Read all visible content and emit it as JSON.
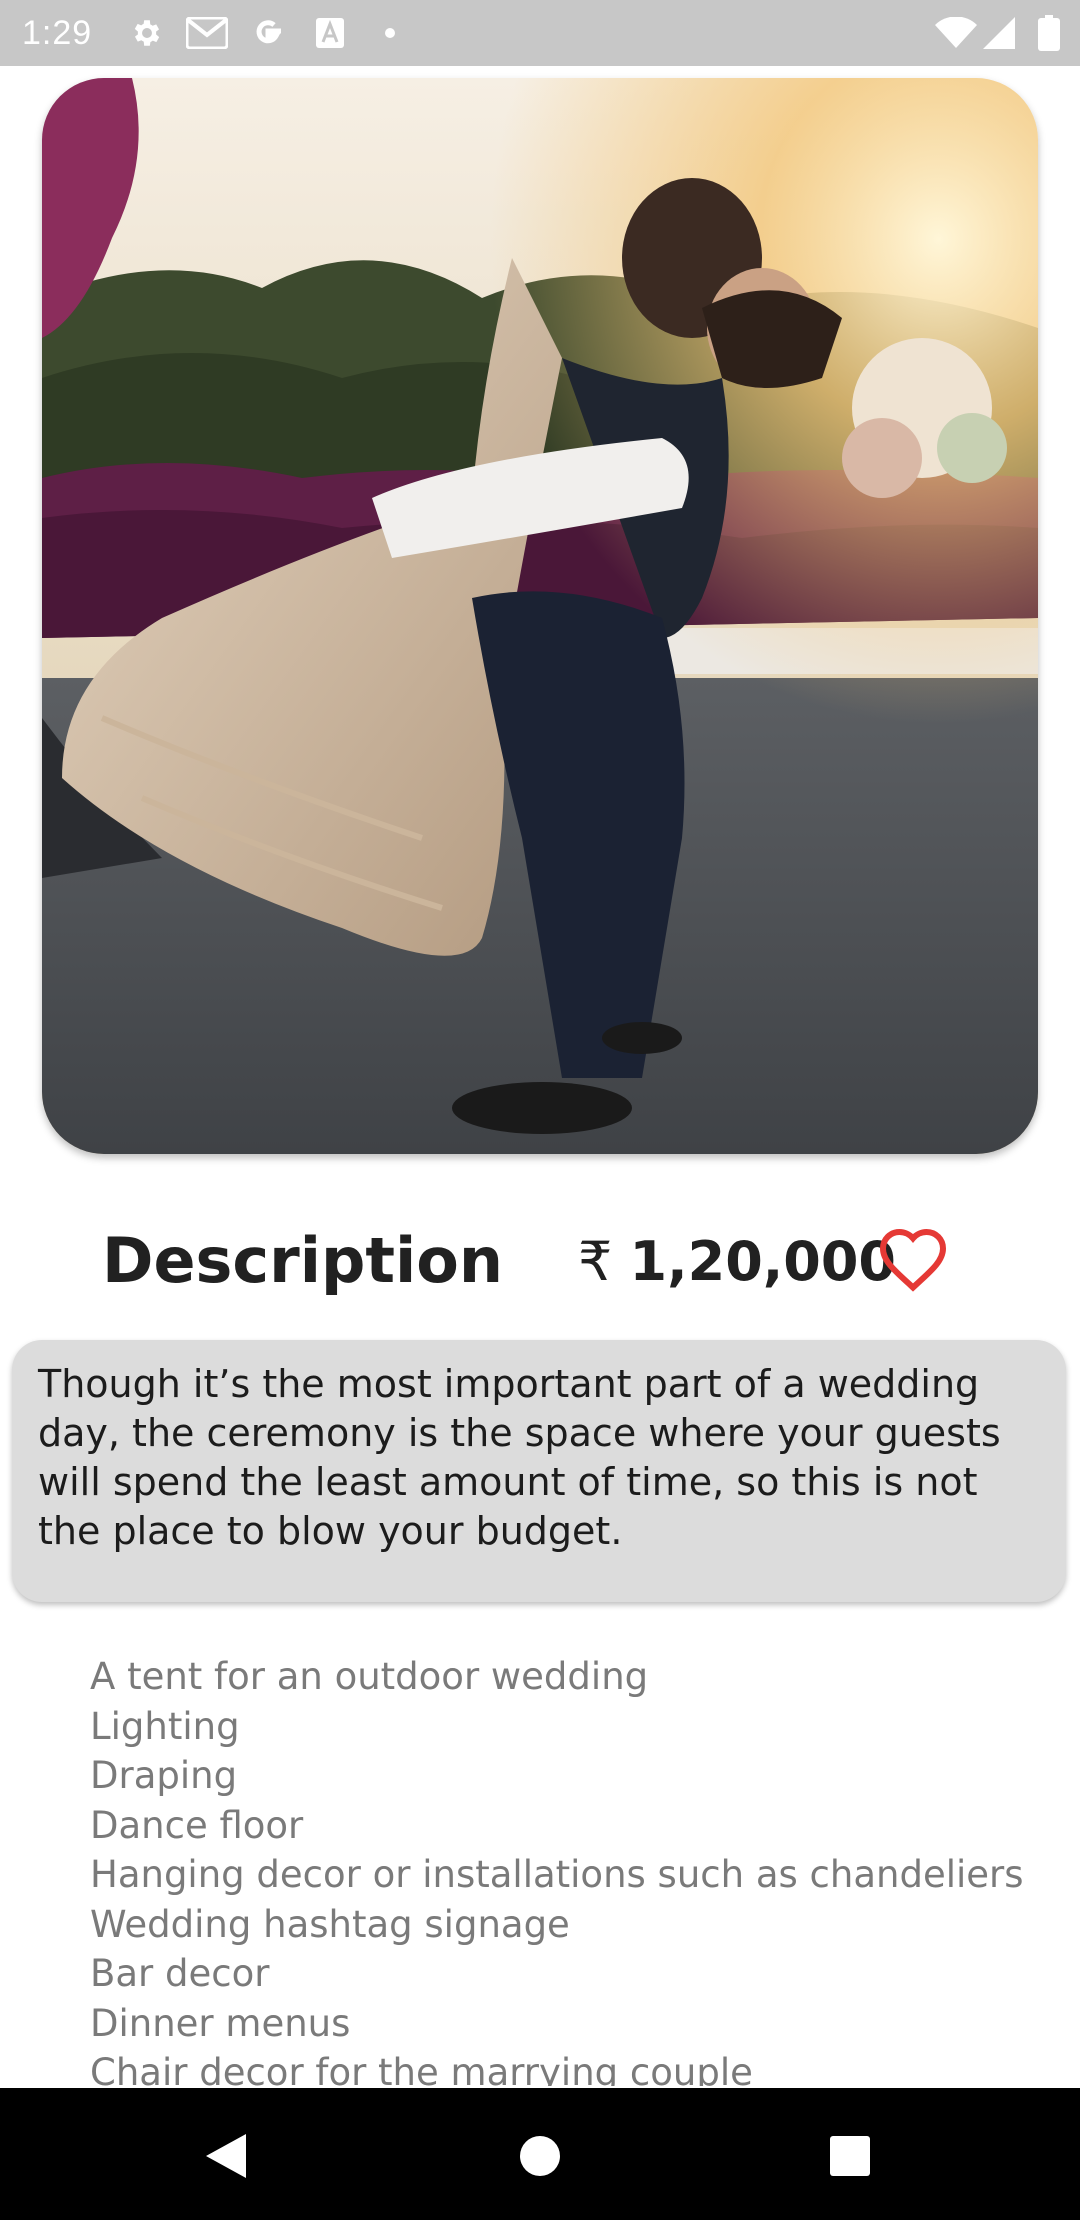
{
  "status_bar": {
    "time": "1:29",
    "icons": [
      "gear-icon",
      "gmail-icon",
      "google-icon",
      "font-icon",
      "dot-icon",
      "wifi-icon",
      "signal-icon",
      "battery-icon"
    ]
  },
  "hero": {
    "image": "wedding-couple-photo"
  },
  "detail": {
    "heading": "Description",
    "price_symbol": "₹",
    "price_value": "1,20,000",
    "favorite_icon": "heart-outline-icon",
    "favorite_color": "#e53935"
  },
  "description": {
    "text": "Though it’s the most important part of a wedding day, the ceremony is the space where your guests will spend the least amount of time, so this is not the place to blow your budget."
  },
  "items": [
    "A tent for an outdoor wedding",
    "Lighting",
    "Draping",
    "Dance floor",
    "Hanging decor or installations such as chandeliers",
    "Wedding hashtag signage",
    "Bar decor",
    "Dinner menus",
    "Chair decor for the marrying couple"
  ],
  "nav_bar": {
    "buttons": [
      "back-icon",
      "home-icon",
      "recents-icon"
    ]
  },
  "colors": {
    "status_bar": "#c7c7c7",
    "card_background": "#dcdcdc",
    "list_text": "#7a7a7a",
    "heading_text": "#212121"
  }
}
